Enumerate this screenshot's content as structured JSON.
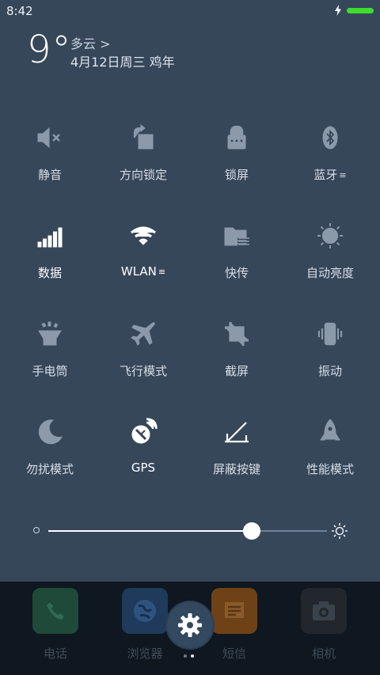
{
  "status_bar": {
    "time": "8:42"
  },
  "weather": {
    "temperature": "9°",
    "condition": "多云 >",
    "date": "4月12日周三  鸡年"
  },
  "toggles": [
    {
      "label": "静音",
      "icon": "mute-icon",
      "on": false
    },
    {
      "label": "方向锁定",
      "icon": "rotation-lock-icon",
      "on": false
    },
    {
      "label": "锁屏",
      "icon": "lock-icon",
      "on": false
    },
    {
      "label": "蓝牙",
      "icon": "bluetooth-icon",
      "on": false,
      "menu": "≡"
    },
    {
      "label": "数据",
      "icon": "signal-icon",
      "on": true
    },
    {
      "label": "WLAN",
      "icon": "wifi-icon",
      "on": true,
      "menu": "≡"
    },
    {
      "label": "快传",
      "icon": "folder-transfer-icon",
      "on": false
    },
    {
      "label": "自动亮度",
      "icon": "auto-brightness-icon",
      "on": false
    },
    {
      "label": "手电筒",
      "icon": "flashlight-icon",
      "on": false
    },
    {
      "label": "飞行模式",
      "icon": "airplane-icon",
      "on": false
    },
    {
      "label": "截屏",
      "icon": "crop-icon",
      "on": false
    },
    {
      "label": "振动",
      "icon": "vibrate-icon",
      "on": false
    },
    {
      "label": "勿扰模式",
      "icon": "moon-icon",
      "on": false
    },
    {
      "label": "GPS",
      "icon": "gps-icon",
      "on": true
    },
    {
      "label": "屏蔽按键",
      "icon": "block-keys-icon",
      "on": false
    },
    {
      "label": "性能模式",
      "icon": "rocket-icon",
      "on": false
    }
  ],
  "brightness": {
    "level": 0.73
  },
  "dock": [
    {
      "label": "电话",
      "icon": "phone-icon",
      "color": "#1f4a3a"
    },
    {
      "label": "浏览器",
      "icon": "browser-icon",
      "color": "#1f3a5a"
    },
    {
      "label": "短信",
      "icon": "message-icon",
      "color": "#6e4216"
    },
    {
      "label": "相机",
      "icon": "camera-icon",
      "color": "#22272d"
    }
  ],
  "colors": {
    "background": "#36475A",
    "battery": "#3ddc2f",
    "dock": "#0f1720"
  }
}
